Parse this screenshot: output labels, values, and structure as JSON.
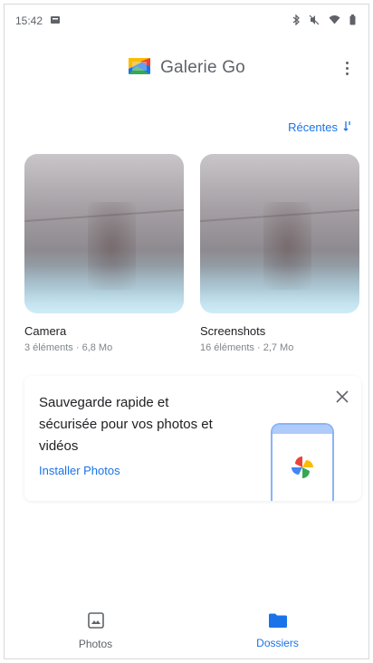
{
  "status_bar": {
    "time": "15:42"
  },
  "app_bar": {
    "title": "Galerie Go"
  },
  "sort": {
    "label": "Récentes"
  },
  "folders": [
    {
      "name": "Camera",
      "meta": "3 éléments · 6,8 Mo"
    },
    {
      "name": "Screenshots",
      "meta": "16 éléments · 2,7 Mo"
    }
  ],
  "promo": {
    "text": "Sauvegarde rapide et sécurisée pour vos photos et vidéos",
    "link": "Installer Photos"
  },
  "bottom_nav": {
    "items": [
      {
        "label": "Photos"
      },
      {
        "label": "Dossiers"
      }
    ]
  },
  "colors": {
    "accent": "#1a73e8"
  }
}
